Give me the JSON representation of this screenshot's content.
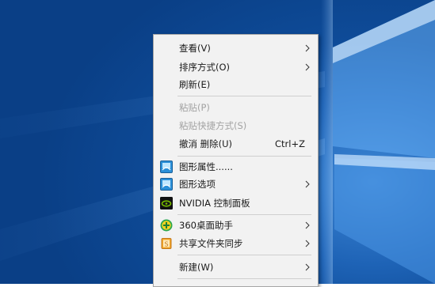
{
  "context_menu": {
    "items": [
      {
        "label": "查看(V)",
        "submenu": true
      },
      {
        "label": "排序方式(O)",
        "submenu": true
      },
      {
        "label": "刷新(E)"
      },
      {
        "label": "粘贴(P)",
        "disabled": true
      },
      {
        "label": "粘贴快捷方式(S)",
        "disabled": true
      },
      {
        "label": "撤消 删除(U)",
        "accelerator": "Ctrl+Z"
      },
      {
        "label": "图形属性......",
        "icon": "intel-graphics-icon"
      },
      {
        "label": "图形选项",
        "icon": "intel-graphics-icon",
        "submenu": true
      },
      {
        "label": "NVIDIA 控制面板",
        "icon": "nvidia-icon"
      },
      {
        "label": "360桌面助手",
        "icon": "360-plus-icon",
        "submenu": true
      },
      {
        "label": "共享文件夹同步",
        "icon": "sync-folder-icon",
        "submenu": true
      },
      {
        "label": "新建(W)",
        "submenu": true
      }
    ]
  },
  "colors": {
    "menu_background": "#f2f2f2",
    "disabled_text": "#a3a3a3",
    "desktop_blue": "#0e4b98"
  }
}
